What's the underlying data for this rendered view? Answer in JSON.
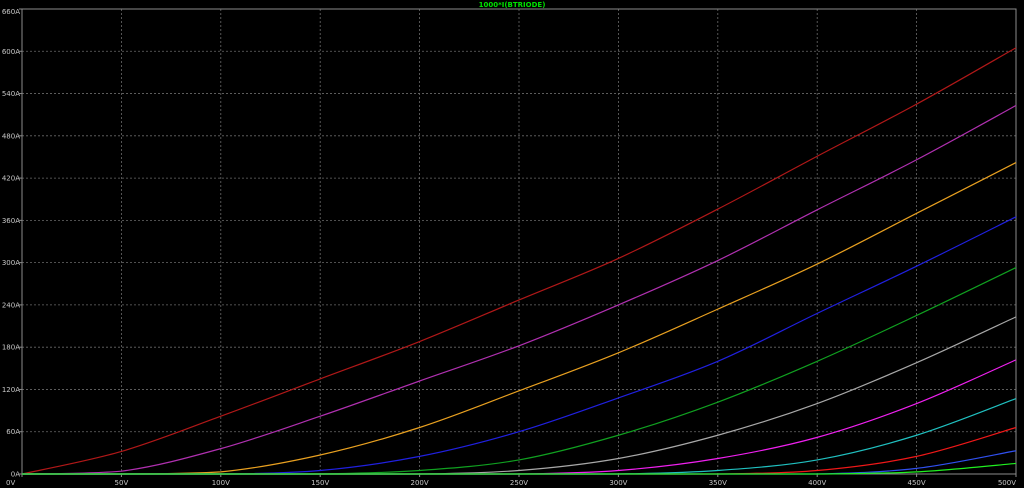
{
  "chart_data": {
    "type": "line",
    "title": "1000*I(BTRIODE)",
    "title_color": "#00e000",
    "xlabel": "",
    "ylabel": "",
    "xlim": [
      0,
      500
    ],
    "ylim": [
      0,
      660
    ],
    "grid": true,
    "x_ticks": [
      "0V",
      "50V",
      "100V",
      "150V",
      "200V",
      "250V",
      "300V",
      "350V",
      "400V",
      "450V",
      "500V"
    ],
    "y_ticks": [
      "0A",
      "60A",
      "120A",
      "180A",
      "240A",
      "300A",
      "360A",
      "420A",
      "480A",
      "540A",
      "600A",
      "660A"
    ],
    "x": [
      0,
      50,
      100,
      150,
      200,
      250,
      300,
      350,
      400,
      450,
      500
    ],
    "series": [
      {
        "color": "#b01818",
        "values": [
          0,
          32,
          82,
          135,
          188,
          247,
          306,
          376,
          451,
          525,
          605
        ]
      },
      {
        "color": "#b030b0",
        "values": [
          0,
          4,
          36,
          82,
          132,
          182,
          240,
          303,
          375,
          446,
          523
        ]
      },
      {
        "color": "#e8a020",
        "values": [
          0,
          0,
          3,
          27,
          66,
          118,
          172,
          234,
          298,
          370,
          442
        ]
      },
      {
        "color": "#2020e0",
        "values": [
          0,
          0,
          0,
          5,
          25,
          60,
          108,
          160,
          228,
          295,
          365
        ]
      },
      {
        "color": "#10a020",
        "values": [
          0,
          0,
          0,
          0,
          5,
          20,
          55,
          102,
          160,
          225,
          293
        ]
      },
      {
        "color": "#a8a8a8",
        "values": [
          0,
          0,
          0,
          0,
          0,
          5,
          22,
          55,
          100,
          158,
          223
        ]
      },
      {
        "color": "#f020f0",
        "values": [
          0,
          0,
          0,
          0,
          0,
          0,
          5,
          22,
          52,
          100,
          162
        ]
      },
      {
        "color": "#20c0c0",
        "values": [
          0,
          0,
          0,
          0,
          0,
          0,
          0,
          5,
          20,
          55,
          107
        ]
      },
      {
        "color": "#f01818",
        "values": [
          0,
          0,
          0,
          0,
          0,
          0,
          0,
          0,
          5,
          25,
          66
        ]
      },
      {
        "color": "#3050f0",
        "values": [
          0,
          0,
          0,
          0,
          0,
          0,
          0,
          0,
          0,
          8,
          33
        ]
      },
      {
        "color": "#20f020",
        "values": [
          0,
          0,
          0,
          0,
          0,
          0,
          0,
          0,
          0,
          3,
          15
        ]
      }
    ]
  }
}
